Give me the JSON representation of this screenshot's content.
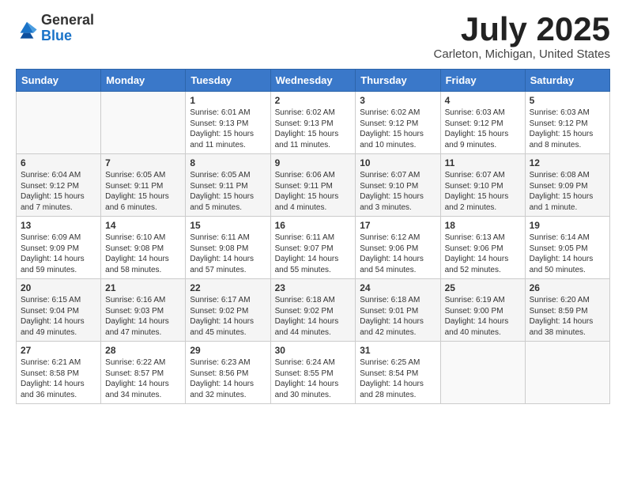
{
  "header": {
    "logo_line1": "General",
    "logo_line2": "Blue",
    "month": "July 2025",
    "location": "Carleton, Michigan, United States"
  },
  "weekdays": [
    "Sunday",
    "Monday",
    "Tuesday",
    "Wednesday",
    "Thursday",
    "Friday",
    "Saturday"
  ],
  "weeks": [
    [
      {
        "day": "",
        "info": ""
      },
      {
        "day": "",
        "info": ""
      },
      {
        "day": "1",
        "info": "Sunrise: 6:01 AM\nSunset: 9:13 PM\nDaylight: 15 hours and 11 minutes."
      },
      {
        "day": "2",
        "info": "Sunrise: 6:02 AM\nSunset: 9:13 PM\nDaylight: 15 hours and 11 minutes."
      },
      {
        "day": "3",
        "info": "Sunrise: 6:02 AM\nSunset: 9:12 PM\nDaylight: 15 hours and 10 minutes."
      },
      {
        "day": "4",
        "info": "Sunrise: 6:03 AM\nSunset: 9:12 PM\nDaylight: 15 hours and 9 minutes."
      },
      {
        "day": "5",
        "info": "Sunrise: 6:03 AM\nSunset: 9:12 PM\nDaylight: 15 hours and 8 minutes."
      }
    ],
    [
      {
        "day": "6",
        "info": "Sunrise: 6:04 AM\nSunset: 9:12 PM\nDaylight: 15 hours and 7 minutes."
      },
      {
        "day": "7",
        "info": "Sunrise: 6:05 AM\nSunset: 9:11 PM\nDaylight: 15 hours and 6 minutes."
      },
      {
        "day": "8",
        "info": "Sunrise: 6:05 AM\nSunset: 9:11 PM\nDaylight: 15 hours and 5 minutes."
      },
      {
        "day": "9",
        "info": "Sunrise: 6:06 AM\nSunset: 9:11 PM\nDaylight: 15 hours and 4 minutes."
      },
      {
        "day": "10",
        "info": "Sunrise: 6:07 AM\nSunset: 9:10 PM\nDaylight: 15 hours and 3 minutes."
      },
      {
        "day": "11",
        "info": "Sunrise: 6:07 AM\nSunset: 9:10 PM\nDaylight: 15 hours and 2 minutes."
      },
      {
        "day": "12",
        "info": "Sunrise: 6:08 AM\nSunset: 9:09 PM\nDaylight: 15 hours and 1 minute."
      }
    ],
    [
      {
        "day": "13",
        "info": "Sunrise: 6:09 AM\nSunset: 9:09 PM\nDaylight: 14 hours and 59 minutes."
      },
      {
        "day": "14",
        "info": "Sunrise: 6:10 AM\nSunset: 9:08 PM\nDaylight: 14 hours and 58 minutes."
      },
      {
        "day": "15",
        "info": "Sunrise: 6:11 AM\nSunset: 9:08 PM\nDaylight: 14 hours and 57 minutes."
      },
      {
        "day": "16",
        "info": "Sunrise: 6:11 AM\nSunset: 9:07 PM\nDaylight: 14 hours and 55 minutes."
      },
      {
        "day": "17",
        "info": "Sunrise: 6:12 AM\nSunset: 9:06 PM\nDaylight: 14 hours and 54 minutes."
      },
      {
        "day": "18",
        "info": "Sunrise: 6:13 AM\nSunset: 9:06 PM\nDaylight: 14 hours and 52 minutes."
      },
      {
        "day": "19",
        "info": "Sunrise: 6:14 AM\nSunset: 9:05 PM\nDaylight: 14 hours and 50 minutes."
      }
    ],
    [
      {
        "day": "20",
        "info": "Sunrise: 6:15 AM\nSunset: 9:04 PM\nDaylight: 14 hours and 49 minutes."
      },
      {
        "day": "21",
        "info": "Sunrise: 6:16 AM\nSunset: 9:03 PM\nDaylight: 14 hours and 47 minutes."
      },
      {
        "day": "22",
        "info": "Sunrise: 6:17 AM\nSunset: 9:02 PM\nDaylight: 14 hours and 45 minutes."
      },
      {
        "day": "23",
        "info": "Sunrise: 6:18 AM\nSunset: 9:02 PM\nDaylight: 14 hours and 44 minutes."
      },
      {
        "day": "24",
        "info": "Sunrise: 6:18 AM\nSunset: 9:01 PM\nDaylight: 14 hours and 42 minutes."
      },
      {
        "day": "25",
        "info": "Sunrise: 6:19 AM\nSunset: 9:00 PM\nDaylight: 14 hours and 40 minutes."
      },
      {
        "day": "26",
        "info": "Sunrise: 6:20 AM\nSunset: 8:59 PM\nDaylight: 14 hours and 38 minutes."
      }
    ],
    [
      {
        "day": "27",
        "info": "Sunrise: 6:21 AM\nSunset: 8:58 PM\nDaylight: 14 hours and 36 minutes."
      },
      {
        "day": "28",
        "info": "Sunrise: 6:22 AM\nSunset: 8:57 PM\nDaylight: 14 hours and 34 minutes."
      },
      {
        "day": "29",
        "info": "Sunrise: 6:23 AM\nSunset: 8:56 PM\nDaylight: 14 hours and 32 minutes."
      },
      {
        "day": "30",
        "info": "Sunrise: 6:24 AM\nSunset: 8:55 PM\nDaylight: 14 hours and 30 minutes."
      },
      {
        "day": "31",
        "info": "Sunrise: 6:25 AM\nSunset: 8:54 PM\nDaylight: 14 hours and 28 minutes."
      },
      {
        "day": "",
        "info": ""
      },
      {
        "day": "",
        "info": ""
      }
    ]
  ]
}
